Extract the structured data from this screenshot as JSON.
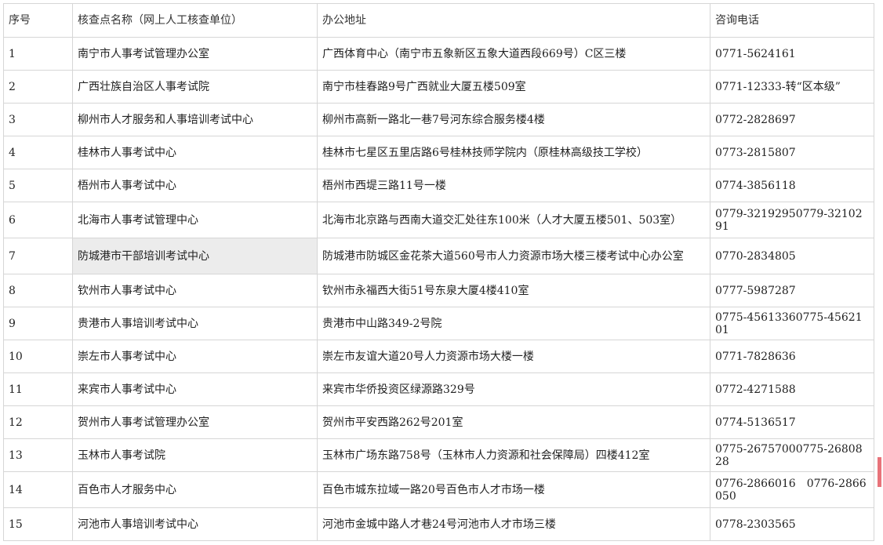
{
  "table": {
    "headers": [
      "序号",
      "核查点名称（网上人工核查单位）",
      "办公地址",
      "咨询电话"
    ],
    "rows": [
      {
        "no": "1",
        "name": "南宁市人事考试管理办公室",
        "address": "广西体育中心（南宁市五象新区五象大道西段669号）C区三楼",
        "phone": "0771-5624161"
      },
      {
        "no": "2",
        "name": "广西壮族自治区人事考试院",
        "address": "南宁市桂春路9号广西就业大厦五楼509室",
        "phone": "0771-12333-转“区本级”"
      },
      {
        "no": "3",
        "name": "柳州市人才服务和人事培训考试中心",
        "address": "柳州市高新一路北一巷7号河东综合服务楼4楼",
        "phone": "0772-2828697"
      },
      {
        "no": "4",
        "name": "桂林市人事考试中心",
        "address": "桂林市七星区五里店路6号桂林技师学院内（原桂林高级技工学校）",
        "phone": "0773-2815807"
      },
      {
        "no": "5",
        "name": "梧州市人事考试中心",
        "address": "梧州市西堤三路11号一楼",
        "phone": "0774-3856118"
      },
      {
        "no": "6",
        "name": "北海市人事考试管理中心",
        "address": "北海市北京路与西南大道交汇处往东100米（人才大厦五楼501、503室）",
        "phone": "0779-32192950779-3210291"
      },
      {
        "no": "7",
        "name": "防城港市干部培训考试中心",
        "address": "防城港市防城区金花茶大道560号市人力资源市场大楼三楼考试中心办公室",
        "phone": "0770-2834805"
      },
      {
        "no": "8",
        "name": "钦州市人事考试中心",
        "address": "钦州市永福西大街51号东泉大厦4楼410室",
        "phone": "0777-5987287"
      },
      {
        "no": "9",
        "name": "贵港市人事培训考试中心",
        "address": "贵港市中山路349-2号院",
        "phone": "0775-45613360775-4562101"
      },
      {
        "no": "10",
        "name": "崇左市人事考试中心",
        "address": "崇左市友谊大道20号人力资源市场大楼一楼",
        "phone": "0771-7828636"
      },
      {
        "no": "11",
        "name": "来宾市人事考试中心",
        "address": "来宾市华侨投资区绿源路329号",
        "phone": "0772-4271588"
      },
      {
        "no": "12",
        "name": "贺州市人事考试管理办公室",
        "address": "贺州市平安西路262号201室",
        "phone": "0774-5136517"
      },
      {
        "no": "13",
        "name": "玉林市人事考试院",
        "address": "玉林市广场东路758号（玉林市人力资源和社会保障局）四楼412室",
        "phone": "0775-26757000775-2680828"
      },
      {
        "no": "14",
        "name": "百色市人才服务中心",
        "address": "百色市城东拉域一路20号百色市人才市场一楼",
        "phone": "0776-2866016　0776-2866050"
      },
      {
        "no": "15",
        "name": "河池市人事培训考试中心",
        "address": "河池市金城中路人才巷24号河池市人才市场三楼",
        "phone": "0778-2303565"
      }
    ]
  }
}
